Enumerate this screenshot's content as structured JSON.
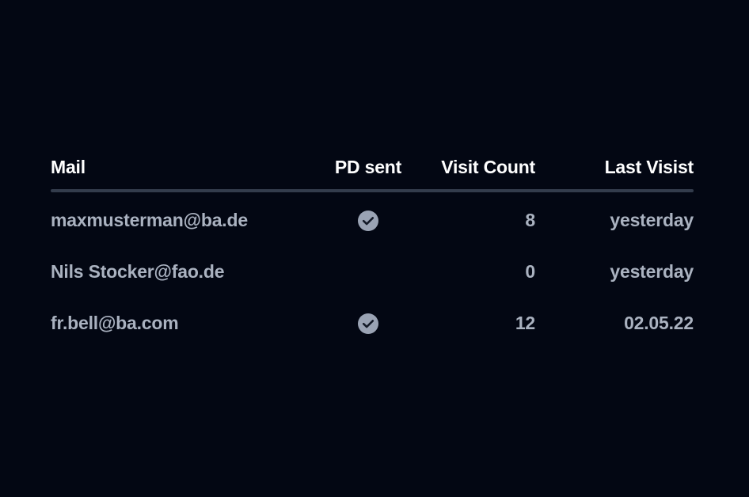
{
  "colors": {
    "background": "#030713",
    "header_text": "#ffffff",
    "body_text": "#aab2c0",
    "divider": "#333c4c",
    "icon_circle": "#9aa3b4",
    "icon_check": "#141a28"
  },
  "table": {
    "columns": [
      {
        "key": "mail",
        "label": "Mail",
        "align": "left"
      },
      {
        "key": "pd",
        "label": "PD sent",
        "align": "center"
      },
      {
        "key": "visits",
        "label": "Visit Count",
        "align": "right"
      },
      {
        "key": "last",
        "label": "Last Visist",
        "align": "right"
      }
    ],
    "rows": [
      {
        "mail": "maxmusterman@ba.de",
        "pd_sent": true,
        "pd_icon": "check-circle-icon",
        "visit_count": "8",
        "last_visit": "yesterday"
      },
      {
        "mail": "Nils Stocker@fao.de",
        "pd_sent": false,
        "pd_icon": "",
        "visit_count": "0",
        "last_visit": "yesterday"
      },
      {
        "mail": "fr.bell@ba.com",
        "pd_sent": true,
        "pd_icon": "check-circle-icon",
        "visit_count": "12",
        "last_visit": "02.05.22"
      }
    ]
  }
}
